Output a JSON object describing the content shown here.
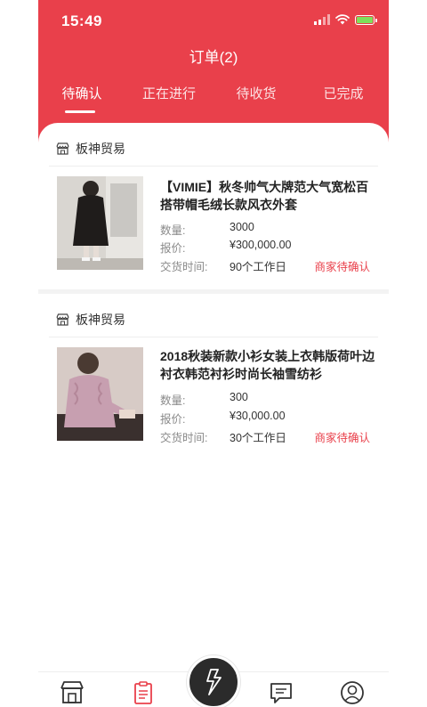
{
  "status_bar": {
    "time": "15:49"
  },
  "header": {
    "title": "订单(2)"
  },
  "tabs": [
    {
      "label": "待确认",
      "active": true
    },
    {
      "label": "正在进行",
      "active": false
    },
    {
      "label": "待收货",
      "active": false
    },
    {
      "label": "已完成",
      "active": false
    }
  ],
  "orders": [
    {
      "shop": "板神贸易",
      "product_name": "【VIMIE】秋冬帅气大牌范大气宽松百搭带帽毛绒长款风衣外套",
      "qty_label": "数量:",
      "qty": "3000",
      "price_label": "报价:",
      "price": "¥300,000.00",
      "delivery_label": "交货时间:",
      "delivery": "90个工作日",
      "status": "商家待确认"
    },
    {
      "shop": "板神贸易",
      "product_name": "2018秋装新款小衫女装上衣韩版荷叶边衬衣韩范衬衫时尚长袖雪纺衫",
      "qty_label": "数量:",
      "qty": "300",
      "price_label": "报价:",
      "price": "¥30,000.00",
      "delivery_label": "交货时间:",
      "delivery": "30个工作日",
      "status": "商家待确认"
    }
  ],
  "colors": {
    "brand": "#e9404b",
    "status": "#e9404b"
  },
  "tabbar": {
    "icons": [
      "shop-icon",
      "orders-icon",
      "lightning-icon",
      "message-icon",
      "user-icon"
    ],
    "active": "orders-icon"
  }
}
